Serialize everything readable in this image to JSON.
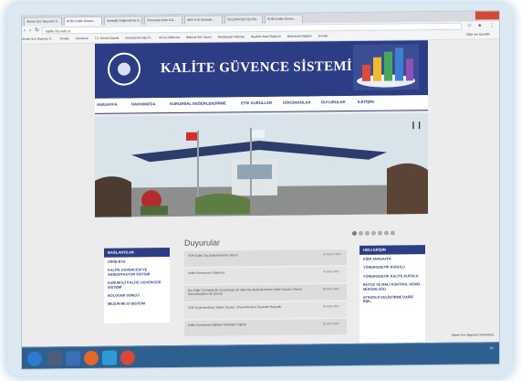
{
  "browser": {
    "tabs": [
      {
        "label": "Ahmet Sırrı Bayındır Ü..."
      },
      {
        "label": "KÜİLİ Kalite Güven..."
      },
      {
        "label": "Stratejik Değlendirme D..."
      },
      {
        "label": "Üniversite birim KG..."
      },
      {
        "label": "ABS & İA Süreçler..."
      },
      {
        "label": "ÖZLÜK/KİŞİL İŞLEM..."
      },
      {
        "label": "KÜİLİ Kalite Güven..."
      }
    ],
    "url": "kalite.ibu.edu.tr",
    "bookmarks": [
      "Ahmet Sırrı Bayındır Ü...",
      "Google",
      "Facebook",
      "T.C. Resmi Gazete",
      "Dokümanlar bilgi Ar...",
      "Akıl İş Platformu",
      "Bilimsel Etki Yazımı",
      "Medikapsül Videoları",
      "Beyinler Nasıl Düşünür",
      "Beyinimde Değişim",
      "Google"
    ],
    "other_bookmarks": "Diğer yer işaretleri"
  },
  "site": {
    "title": "KALİTE GÜVENCE SİSTEMİ",
    "brand_color": "#2c3d86",
    "nav": [
      "ANASAYFA",
      "HAKKIMIZDA",
      "KURUMSAL DEĞERLENDİRME",
      "ETİK KURULLAR",
      "DÖKÜMANLAR",
      "DUYURULAR",
      "İLETİŞİM"
    ],
    "slider_dots": 7,
    "slider_active": 0
  },
  "left_box": {
    "heading": "BAĞLANTILAR",
    "items": [
      "GİRİŞ-BYS",
      "KALİTE GÜVENCESİ VE AKREDİTASYON SİSTEMİ",
      "KURUM İÇİ KALİTE GÜVENCESİ SİSTEMİ",
      "BOLOGNA SÜRECİ",
      "MEZUN BİLGİ SİSTEMİ"
    ]
  },
  "announcements": {
    "title": "Duyurular",
    "items": [
      {
        "text": "YÖK Kalite Dış Değerlendirme Süreci",
        "date": "14 Kasım 2017"
      },
      {
        "text": "Kalite Komisyonu Toplantısı",
        "date": "07 Ekim 2017"
      },
      {
        "text": "Dış Kalite Ta Hareketle Gerçekleşecek Olan Dış Değerlendirme Kalite Güvenci Süreci Gerçekleştirilen İlk Çizenti",
        "date": "06 Ekim 2017"
      },
      {
        "text": "YÖK Değerlendirme Takımı Üyeleri, Üniversitemize Ziyaretler Bulundu",
        "date": "04 Ekim 2017"
      },
      {
        "text": "Kalite Komisyonu Eğitimci Toplantısı Yapıldı",
        "date": "01 Ekim 2017"
      }
    ]
  },
  "right_box": {
    "heading": "HIZLI ERİŞİM",
    "items": [
      "KİDR ANASAYFA",
      "YÖNERGE/ETİK KURULU",
      "YÖNERGE/ETİK KALİTE KURULU",
      "BÜTÇE VE MALİ KONTROL GENEL MÜDÜRLÜĞÜ",
      "STRATEJİ GELİŞTİRME DAİRE BŞK."
    ]
  },
  "taskbar": {
    "tray_text": "TR",
    "status_text": "Ahmet Sırrı Bayındır Üniversitesi"
  }
}
